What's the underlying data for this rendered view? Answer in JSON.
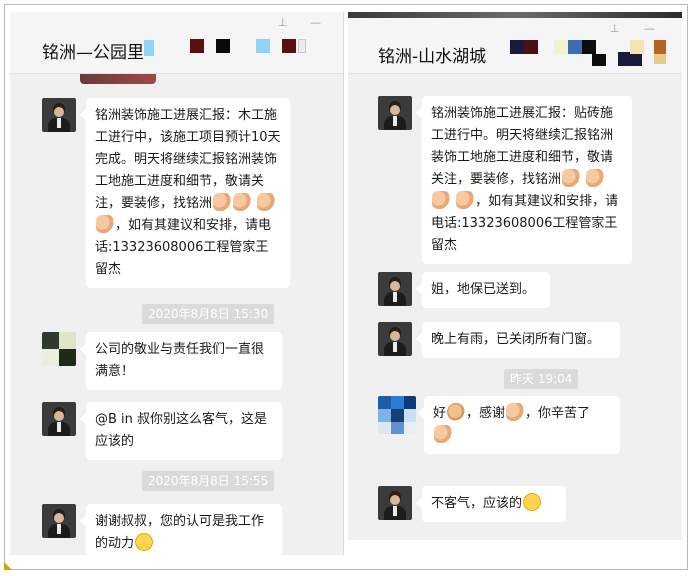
{
  "left_chat": {
    "title": "铭洲—公园里",
    "messages": [
      {
        "text": "铭洲装饰施工进展汇报：木工施工进行中，该施工项目预计10天完成。明天将继续汇报铭洲装饰工地施工进度和细节，敬请关注，要装修，找铭洲",
        "text_after": "，如有其建议和安排，请电话:13323608006工程管家王留杰"
      },
      {
        "timestamp": "2020年8月8日 15:30"
      },
      {
        "text": "公司的敬业与责任我们一直很满意！"
      },
      {
        "text": "@B in 叔你别这么客气，这是应该的"
      },
      {
        "timestamp": "2020年8月8日 15:55"
      },
      {
        "text": "谢谢叔叔，您的认可是我工作的动力"
      }
    ]
  },
  "right_chat": {
    "title": "铭洲-山水湖城",
    "messages": [
      {
        "text": "铭洲装饰施工进展汇报：贴砖施工进行中。明天将继续汇报铭洲装饰工地施工进度和细节，敬请关注，要装修，找铭洲",
        "text_after": "，如有其建议和安排，请电话:13323608006工程管家王留杰"
      },
      {
        "text": "姐，地保已送到。"
      },
      {
        "text": "晚上有雨，已关闭所有门窗。"
      },
      {
        "timestamp": "昨天 19:04"
      },
      {
        "text_a": "好",
        "text_b": "，感谢",
        "text_c": "，你辛苦了"
      },
      {
        "text": "不客气，应该的"
      }
    ]
  },
  "icons": {
    "avatar": "person-avatar-icon",
    "handshake": "handshake-emoji-icon",
    "pray": "praying-hands-emoji-icon",
    "smile": "smile-emoji-icon",
    "ok": "ok-hand-emoji-icon"
  },
  "colors": {
    "panel_bg": "#f0f0f0",
    "bubble_bg": "#ffffff",
    "timestamp_bg": "#dadada"
  }
}
